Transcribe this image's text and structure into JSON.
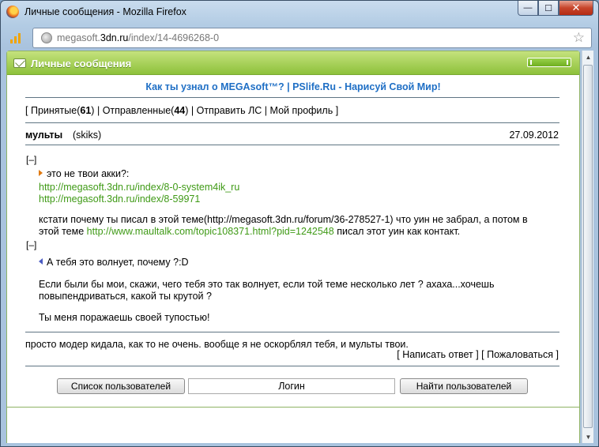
{
  "window": {
    "title": "Личные сообщения - Mozilla Firefox",
    "minimize": "—",
    "maximize": "☐",
    "close": "✕"
  },
  "address": {
    "prefix": "megasoft.",
    "domain": "3dn.ru",
    "path": "/index/14-4696268-0"
  },
  "panel": {
    "title": "Личные сообщения"
  },
  "promo": {
    "link1": "Как ты узнал о MEGAsoft™?",
    "separator": "|",
    "link2": "PSlife.Ru - Нарисуй Свой Мир!"
  },
  "nav": {
    "open": "[",
    "inbox_label": "Принятые(",
    "inbox_count": "61",
    "inbox_close": ")",
    "sep1": "|",
    "sent_label": "Отправленные(",
    "sent_count": "44",
    "sent_close": ")",
    "sep2": "|",
    "send": "Отправить ЛС",
    "sep3": "|",
    "profile": "Мой профиль",
    "close": "]"
  },
  "message": {
    "subject": "мульты",
    "from": "(skiks)",
    "date": "27.09.2012",
    "toggle1": "[–]",
    "toggle2": "[–]",
    "q1_line": "это не твои акки?:",
    "q1_link1": "http://megasoft.3dn.ru/index/8-0-system4ik_ru",
    "q1_link2": "http://megasoft.3dn.ru/index/8-59971",
    "q1_text_a": "кстати почему ты писал в этой теме(http://megasoft.3dn.ru/forum/36-278527-1) что уин не забрал, а потом в",
    "q1_text_b_pre": "этой теме",
    "q1_text_b_link": "http://www.maultalk.com/topic108371.html?pid=1242548",
    "q1_text_b_post": "писал этот уин как контакт.",
    "q2_line": "А тебя это волнует, почему ?:D",
    "q2_text_a": "Если были бы мои, скажи, чего тебя это так волнует, если той теме несколько лет ? ахаха...хочешь",
    "q2_text_b": "повыпендриваться, какой ты крутой ?",
    "q2_text_c": "Ты меня поражаешь своей тупостью!",
    "body": "просто модер кидала, как то не очень. вообще я не оскорблял тебя, и мульты твои."
  },
  "actions": {
    "reply": "Написать ответ",
    "complain": "Пожаловаться"
  },
  "footer": {
    "users_button": "Список пользователей",
    "search_value": "Логин",
    "find_button": "Найти пользователей"
  }
}
